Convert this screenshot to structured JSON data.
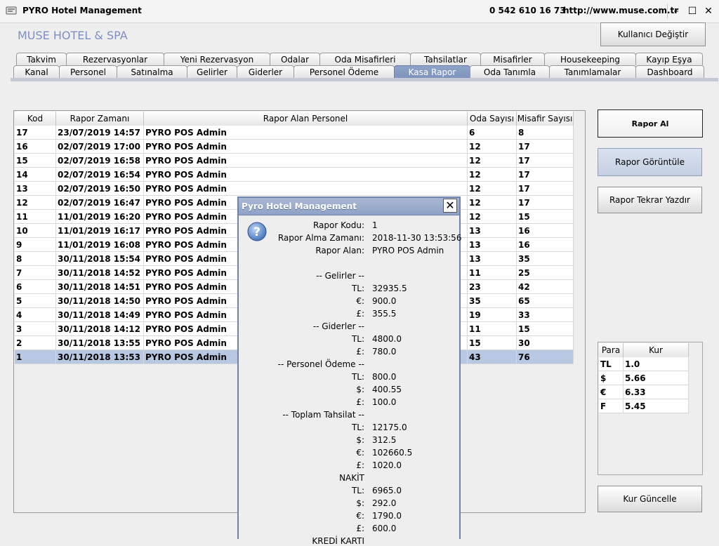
{
  "window": {
    "title": "PYRO Hotel Management",
    "phone": "0 542 610 16 73",
    "url": "http://www.muse.com.tr",
    "minimize": "–",
    "maximize": "☐",
    "close": "✕"
  },
  "hotel_name": "MUSE HOTEL & SPA",
  "user_button": "Kullanıcı Değiştir",
  "tabs_row1": [
    "Takvim",
    "Rezervasyonlar",
    "Yeni Rezervasyon",
    "Odalar",
    "Oda Misafirleri",
    "Tahsilatlar",
    "Misafirler",
    "Housekeeping",
    "Kayıp Eşya"
  ],
  "tabs_row2": [
    "Kanal",
    "Personel",
    "Satınalma",
    "Gelirler",
    "Giderler",
    "Personel Ödeme",
    "Kasa Rapor",
    "Oda Tanımla",
    "Tanımlamalar",
    "Dashboard"
  ],
  "active_tab": "Kasa Rapor",
  "table": {
    "headers": [
      "Kod",
      "Rapor Zamanı",
      "Rapor Alan Personel",
      "Oda Sayısı",
      "Misafir Sayısı"
    ],
    "rows": [
      [
        "17",
        "23/07/2019 14:57",
        "PYRO POS Admin",
        "6",
        "8"
      ],
      [
        "16",
        "02/07/2019 17:00",
        "PYRO POS Admin",
        "12",
        "17"
      ],
      [
        "15",
        "02/07/2019 16:58",
        "PYRO POS Admin",
        "12",
        "17"
      ],
      [
        "14",
        "02/07/2019 16:54",
        "PYRO POS Admin",
        "12",
        "17"
      ],
      [
        "13",
        "02/07/2019 16:50",
        "PYRO POS Admin",
        "12",
        "17"
      ],
      [
        "12",
        "02/07/2019 16:47",
        "PYRO POS Admin",
        "12",
        "17"
      ],
      [
        "11",
        "11/01/2019 16:20",
        "PYRO POS Admin",
        "12",
        "15"
      ],
      [
        "10",
        "11/01/2019 16:17",
        "PYRO POS Admin",
        "13",
        "16"
      ],
      [
        "9",
        "11/01/2019 16:08",
        "PYRO POS Admin",
        "13",
        "16"
      ],
      [
        "8",
        "30/11/2018 15:54",
        "PYRO POS Admin",
        "13",
        "35"
      ],
      [
        "7",
        "30/11/2018 14:52",
        "PYRO POS Admin",
        "11",
        "25"
      ],
      [
        "6",
        "30/11/2018 14:51",
        "PYRO POS Admin",
        "23",
        "42"
      ],
      [
        "5",
        "30/11/2018 14:50",
        "PYRO POS Admin",
        "35",
        "65"
      ],
      [
        "4",
        "30/11/2018 14:49",
        "PYRO POS Admin",
        "19",
        "33"
      ],
      [
        "3",
        "30/11/2018 14:12",
        "PYRO POS Admin",
        "11",
        "15"
      ],
      [
        "2",
        "30/11/2018 13:55",
        "PYRO POS Admin",
        "15",
        "30"
      ],
      [
        "1",
        "30/11/2018 13:53",
        "PYRO POS Admin",
        "43",
        "76"
      ]
    ],
    "selected_row": 16
  },
  "side_buttons": {
    "take_report": "Rapor Al",
    "view_report": "Rapor Görüntüle",
    "reprint_report": "Rapor Tekrar Yazdır",
    "update_rates": "Kur Güncelle"
  },
  "rates": {
    "headers": [
      "Para",
      "Kur"
    ],
    "rows": [
      [
        "TL",
        "1.0"
      ],
      [
        "$",
        "5.66"
      ],
      [
        "€",
        "6.33"
      ],
      [
        "F",
        "5.45"
      ]
    ]
  },
  "dialog": {
    "title": "Pyro Hotel Management",
    "close": "✕",
    "icon": "question-icon",
    "lines": [
      [
        "Rapor Kodu:",
        "1"
      ],
      [
        "Rapor Alma Zamanı:",
        "2018-11-30 13:53:56"
      ],
      [
        "Rapor Alan:",
        "PYRO POS Admin"
      ],
      [
        "",
        ""
      ],
      [
        "-- Gelirler --",
        ""
      ],
      [
        "TL:",
        "32935.5"
      ],
      [
        "€:",
        "900.0"
      ],
      [
        "£:",
        "355.5"
      ],
      [
        "-- Giderler --",
        ""
      ],
      [
        "TL:",
        "4800.0"
      ],
      [
        "£:",
        "780.0"
      ],
      [
        "-- Personel Ödeme --",
        ""
      ],
      [
        "TL:",
        "800.0"
      ],
      [
        "$:",
        "400.55"
      ],
      [
        "£:",
        "100.0"
      ],
      [
        "-- Toplam Tahsilat --",
        ""
      ],
      [
        "TL:",
        "12175.0"
      ],
      [
        "$:",
        "312.5"
      ],
      [
        "€:",
        "102660.5"
      ],
      [
        "£:",
        "1020.0"
      ],
      [
        "NAKİT",
        ""
      ],
      [
        "TL:",
        "6965.0"
      ],
      [
        "$:",
        "292.0"
      ],
      [
        "€:",
        "1790.0"
      ],
      [
        "£:",
        "600.0"
      ],
      [
        "KREDİ KARTI",
        ""
      ]
    ]
  },
  "colors": {
    "hotel_name": "#7e8fc2",
    "active_tab": "#8ea3c8",
    "selected_row": "#b8c8e2",
    "dialog_title": "#95a7c9"
  }
}
